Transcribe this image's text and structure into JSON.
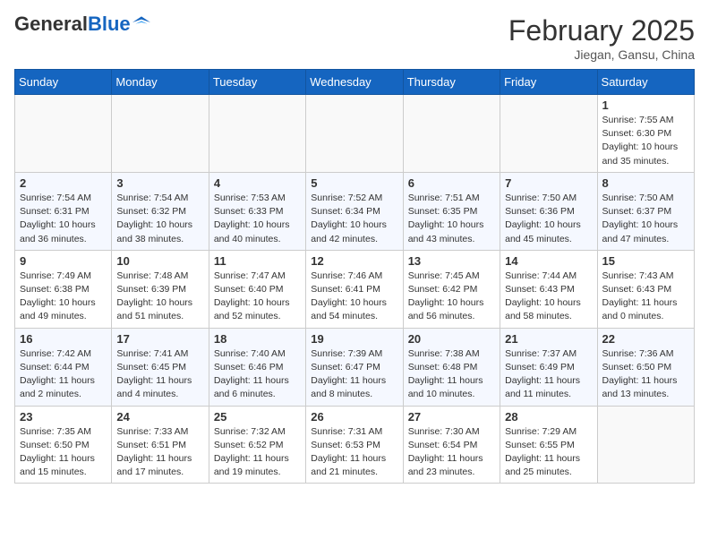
{
  "header": {
    "logo_general": "General",
    "logo_blue": "Blue",
    "month": "February 2025",
    "location": "Jiegan, Gansu, China"
  },
  "weekdays": [
    "Sunday",
    "Monday",
    "Tuesday",
    "Wednesday",
    "Thursday",
    "Friday",
    "Saturday"
  ],
  "weeks": [
    [
      {
        "day": "",
        "info": ""
      },
      {
        "day": "",
        "info": ""
      },
      {
        "day": "",
        "info": ""
      },
      {
        "day": "",
        "info": ""
      },
      {
        "day": "",
        "info": ""
      },
      {
        "day": "",
        "info": ""
      },
      {
        "day": "1",
        "info": "Sunrise: 7:55 AM\nSunset: 6:30 PM\nDaylight: 10 hours and 35 minutes."
      }
    ],
    [
      {
        "day": "2",
        "info": "Sunrise: 7:54 AM\nSunset: 6:31 PM\nDaylight: 10 hours and 36 minutes."
      },
      {
        "day": "3",
        "info": "Sunrise: 7:54 AM\nSunset: 6:32 PM\nDaylight: 10 hours and 38 minutes."
      },
      {
        "day": "4",
        "info": "Sunrise: 7:53 AM\nSunset: 6:33 PM\nDaylight: 10 hours and 40 minutes."
      },
      {
        "day": "5",
        "info": "Sunrise: 7:52 AM\nSunset: 6:34 PM\nDaylight: 10 hours and 42 minutes."
      },
      {
        "day": "6",
        "info": "Sunrise: 7:51 AM\nSunset: 6:35 PM\nDaylight: 10 hours and 43 minutes."
      },
      {
        "day": "7",
        "info": "Sunrise: 7:50 AM\nSunset: 6:36 PM\nDaylight: 10 hours and 45 minutes."
      },
      {
        "day": "8",
        "info": "Sunrise: 7:50 AM\nSunset: 6:37 PM\nDaylight: 10 hours and 47 minutes."
      }
    ],
    [
      {
        "day": "9",
        "info": "Sunrise: 7:49 AM\nSunset: 6:38 PM\nDaylight: 10 hours and 49 minutes."
      },
      {
        "day": "10",
        "info": "Sunrise: 7:48 AM\nSunset: 6:39 PM\nDaylight: 10 hours and 51 minutes."
      },
      {
        "day": "11",
        "info": "Sunrise: 7:47 AM\nSunset: 6:40 PM\nDaylight: 10 hours and 52 minutes."
      },
      {
        "day": "12",
        "info": "Sunrise: 7:46 AM\nSunset: 6:41 PM\nDaylight: 10 hours and 54 minutes."
      },
      {
        "day": "13",
        "info": "Sunrise: 7:45 AM\nSunset: 6:42 PM\nDaylight: 10 hours and 56 minutes."
      },
      {
        "day": "14",
        "info": "Sunrise: 7:44 AM\nSunset: 6:43 PM\nDaylight: 10 hours and 58 minutes."
      },
      {
        "day": "15",
        "info": "Sunrise: 7:43 AM\nSunset: 6:43 PM\nDaylight: 11 hours and 0 minutes."
      }
    ],
    [
      {
        "day": "16",
        "info": "Sunrise: 7:42 AM\nSunset: 6:44 PM\nDaylight: 11 hours and 2 minutes."
      },
      {
        "day": "17",
        "info": "Sunrise: 7:41 AM\nSunset: 6:45 PM\nDaylight: 11 hours and 4 minutes."
      },
      {
        "day": "18",
        "info": "Sunrise: 7:40 AM\nSunset: 6:46 PM\nDaylight: 11 hours and 6 minutes."
      },
      {
        "day": "19",
        "info": "Sunrise: 7:39 AM\nSunset: 6:47 PM\nDaylight: 11 hours and 8 minutes."
      },
      {
        "day": "20",
        "info": "Sunrise: 7:38 AM\nSunset: 6:48 PM\nDaylight: 11 hours and 10 minutes."
      },
      {
        "day": "21",
        "info": "Sunrise: 7:37 AM\nSunset: 6:49 PM\nDaylight: 11 hours and 11 minutes."
      },
      {
        "day": "22",
        "info": "Sunrise: 7:36 AM\nSunset: 6:50 PM\nDaylight: 11 hours and 13 minutes."
      }
    ],
    [
      {
        "day": "23",
        "info": "Sunrise: 7:35 AM\nSunset: 6:50 PM\nDaylight: 11 hours and 15 minutes."
      },
      {
        "day": "24",
        "info": "Sunrise: 7:33 AM\nSunset: 6:51 PM\nDaylight: 11 hours and 17 minutes."
      },
      {
        "day": "25",
        "info": "Sunrise: 7:32 AM\nSunset: 6:52 PM\nDaylight: 11 hours and 19 minutes."
      },
      {
        "day": "26",
        "info": "Sunrise: 7:31 AM\nSunset: 6:53 PM\nDaylight: 11 hours and 21 minutes."
      },
      {
        "day": "27",
        "info": "Sunrise: 7:30 AM\nSunset: 6:54 PM\nDaylight: 11 hours and 23 minutes."
      },
      {
        "day": "28",
        "info": "Sunrise: 7:29 AM\nSunset: 6:55 PM\nDaylight: 11 hours and 25 minutes."
      },
      {
        "day": "",
        "info": ""
      }
    ]
  ]
}
